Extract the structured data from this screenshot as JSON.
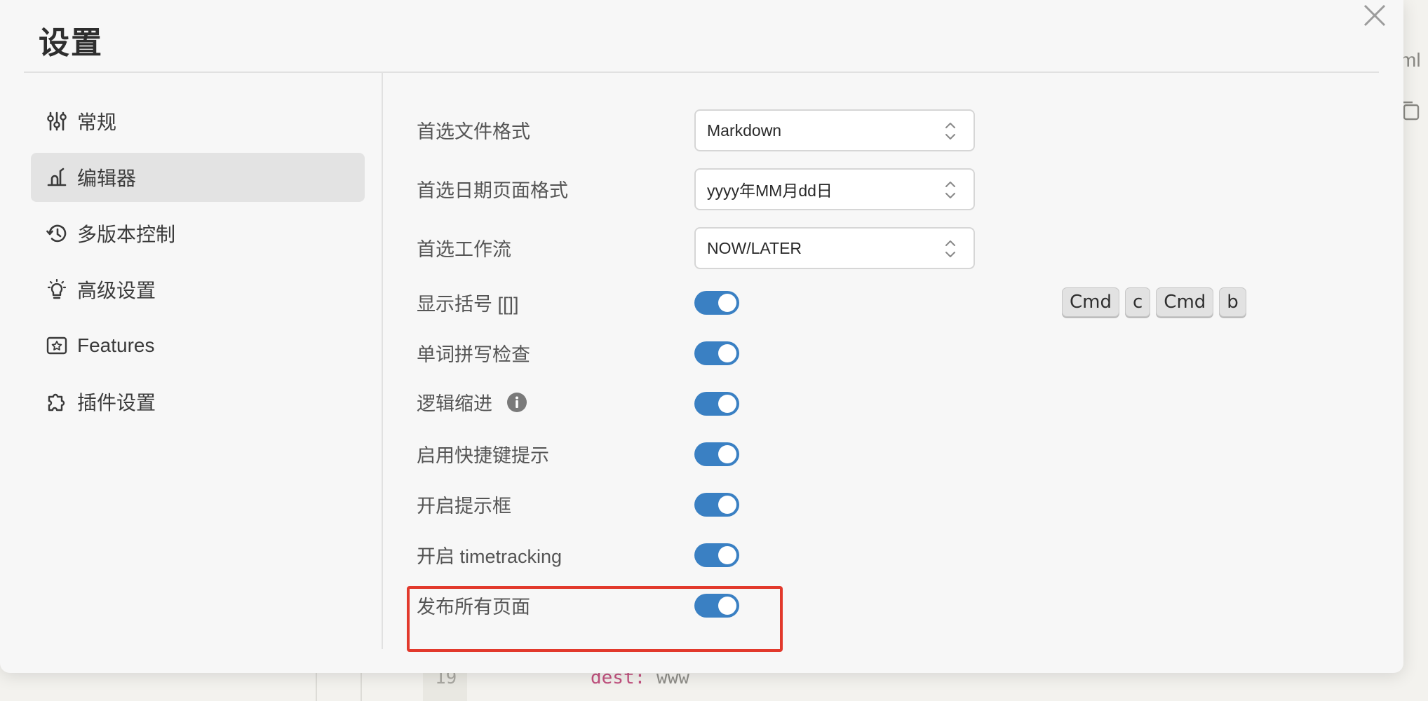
{
  "dialog": {
    "title": "设置",
    "close_icon": "close-icon"
  },
  "sidebar": {
    "items": [
      {
        "label": "常规",
        "icon": "sliders-icon",
        "active": false
      },
      {
        "label": "编辑器",
        "icon": "editor-icon",
        "active": true
      },
      {
        "label": "多版本控制",
        "icon": "history-icon",
        "active": false
      },
      {
        "label": "高级设置",
        "icon": "lightbulb-icon",
        "active": false
      },
      {
        "label": "Features",
        "icon": "image-star-icon",
        "active": false
      },
      {
        "label": "插件设置",
        "icon": "puzzle-icon",
        "active": false
      }
    ]
  },
  "settings": {
    "file_format": {
      "label": "首选文件格式",
      "value": "Markdown"
    },
    "date_format": {
      "label": "首选日期页面格式",
      "value": "yyyy年MM月dd日"
    },
    "workflow": {
      "label": "首选工作流",
      "value": "NOW/LATER"
    },
    "brackets": {
      "label": "显示括号 [[]]",
      "on": true
    },
    "spellcheck": {
      "label": "单词拼写检查",
      "on": true
    },
    "logical_indent": {
      "label": "逻辑缩进",
      "on": true
    },
    "shortcut_tips": {
      "label": "启用快捷键提示",
      "on": true
    },
    "tooltip": {
      "label": "开启提示框",
      "on": true
    },
    "timetracking": {
      "label": "开启 timetracking",
      "on": true
    },
    "publish_all": {
      "label": "发布所有页面",
      "on": true
    }
  },
  "shortcut": {
    "keys": [
      "Cmd",
      "c",
      "Cmd",
      "b"
    ]
  },
  "background": {
    "line_number": "19",
    "code_key": "dest:",
    "code_value": "www",
    "file_ext_fragment": "ml"
  },
  "colors": {
    "toggle_on": "#3a80c3",
    "highlight": "#e2392c",
    "active_nav": "#e3e3e3"
  }
}
